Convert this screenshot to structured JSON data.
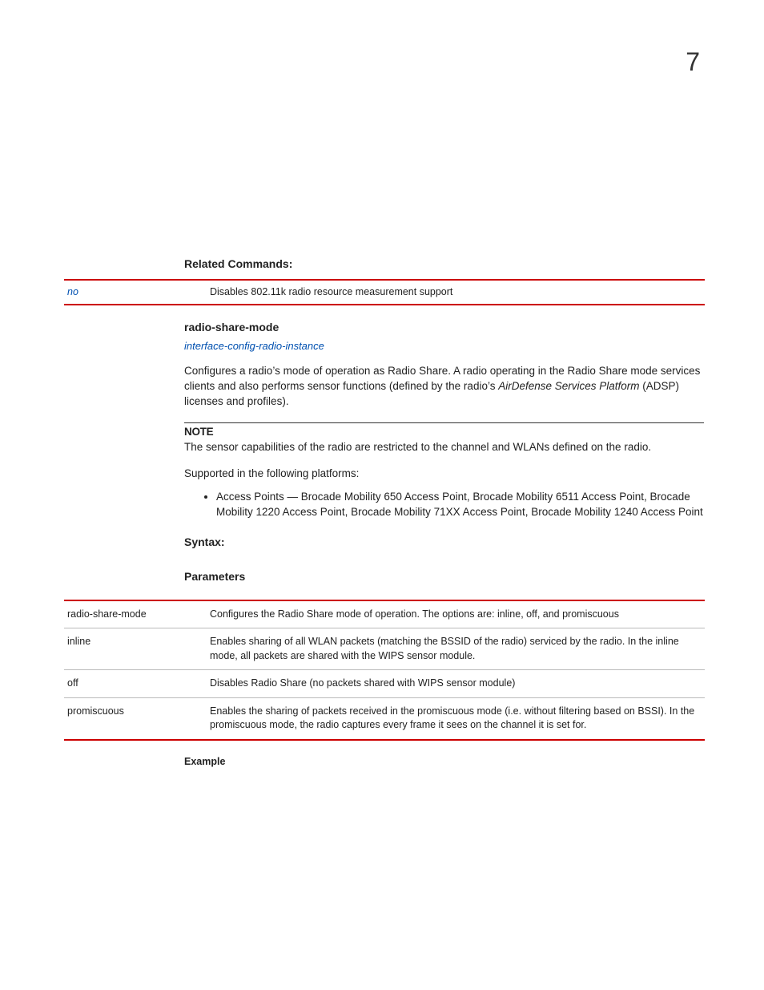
{
  "chapter_number": "7",
  "related_commands_heading": "Related Commands:",
  "related_commands_rows": [
    {
      "cmd": "no",
      "desc": "Disables 802.11k radio resource measurement support"
    }
  ],
  "command_name": "radio-share-mode",
  "xref": "interface-config-radio-instance",
  "intro_plain1": "Configures a radio’s mode of operation as Radio Share. A radio operating in the Radio Share mode services clients and also performs sensor functions (defined by the radio’s ",
  "intro_italic": "AirDefense Services Platform",
  "intro_plain2": " (ADSP) licenses and profiles).",
  "note_label": "NOTE",
  "note_text": "The sensor capabilities of the radio are restricted to the channel and WLANs defined on the radio.",
  "supported_heading": "Supported in the following platforms:",
  "supported_bullet": "Access Points — Brocade Mobility 650 Access Point, Brocade Mobility 6511 Access Point, Brocade Mobility 1220 Access Point, Brocade Mobility 71XX Access Point, Brocade Mobility 1240 Access Point",
  "syntax_label": "Syntax:",
  "parameters_label": "Parameters",
  "parameters_rows": [
    {
      "k": "radio-share-mode",
      "v": "Configures the Radio Share mode of operation. The options are: inline, off, and promiscuous"
    },
    {
      "k": "inline",
      "v": "Enables sharing of all WLAN packets (matching the BSSID of the radio) serviced by the radio. In the inline mode, all packets are shared with the WIPS sensor module."
    },
    {
      "k": "off",
      "v": "Disables Radio Share (no packets shared with WIPS sensor module)"
    },
    {
      "k": "promiscuous",
      "v": "Enables the sharing of packets received in the promiscuous mode (i.e. without filtering based on BSSI). In the promiscuous mode, the radio captures every frame it sees on the channel it is set for."
    }
  ],
  "example_label": "Example"
}
